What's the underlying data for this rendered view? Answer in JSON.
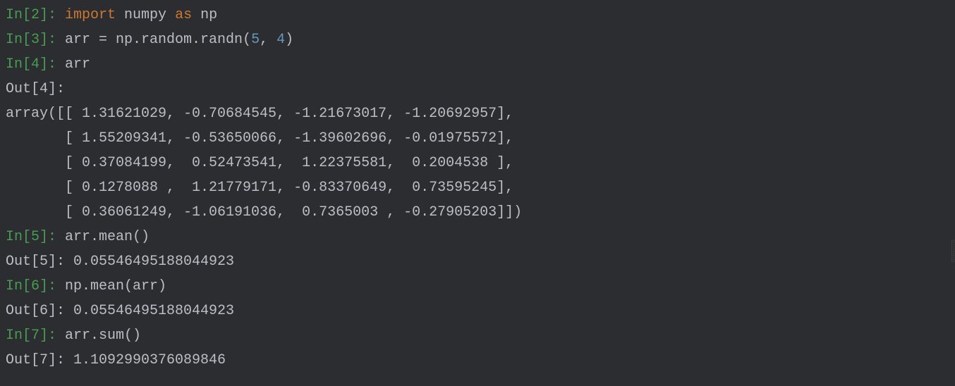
{
  "cells": {
    "c2": {
      "in_label": "In[2]: ",
      "code_tokens": {
        "kw_import": "import",
        "sp1": " ",
        "mod": "numpy",
        "sp2": " ",
        "kw_as": "as",
        "sp3": " ",
        "alias": "np"
      }
    },
    "c3": {
      "in_label": "In[3]: ",
      "code_tokens": {
        "lhs": "arr = np.random.randn(",
        "num1": "5",
        "comma": ", ",
        "num2": "4",
        "rparen": ")"
      }
    },
    "c4": {
      "in_label": "In[4]: ",
      "code": "arr",
      "out_label": "Out[4]:",
      "output_lines": [
        "array([[ 1.31621029, -0.70684545, -1.21673017, -1.20692957],",
        "       [ 1.55209341, -0.53650066, -1.39602696, -0.01975572],",
        "       [ 0.37084199,  0.52473541,  1.22375581,  0.2004538 ],",
        "       [ 0.1278088 ,  1.21779171, -0.83370649,  0.73595245],",
        "       [ 0.36061249, -1.06191036,  0.7365003 , -0.27905203]])"
      ]
    },
    "c5": {
      "in_label": "In[5]: ",
      "code": "arr.mean()",
      "out_label": "Out[5]: ",
      "output": "0.05546495188044923"
    },
    "c6": {
      "in_label": "In[6]: ",
      "code": "np.mean(arr)",
      "out_label": "Out[6]: ",
      "output": "0.05546495188044923"
    },
    "c7": {
      "in_label": "In[7]: ",
      "code": "arr.sum()",
      "out_label": "Out[7]: ",
      "output": "1.1092990376089846"
    }
  }
}
